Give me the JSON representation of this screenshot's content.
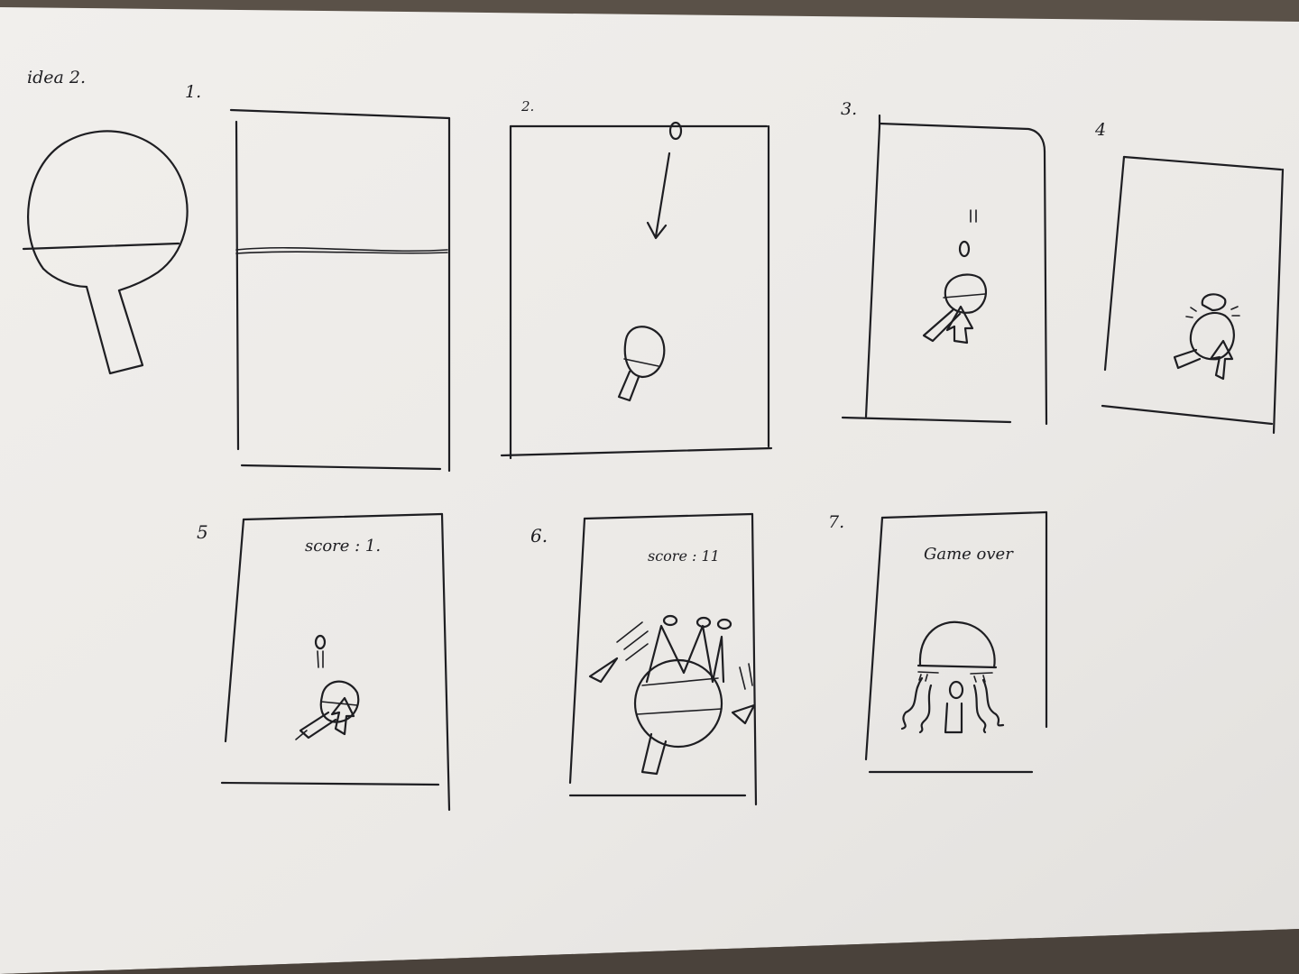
{
  "sheet": {
    "heading": "idea 2.",
    "colors": {
      "paper": "#eeecea",
      "ink": "#1e1e22",
      "background": "#5a5148"
    }
  },
  "panels": [
    {
      "number": "1.",
      "caption": ""
    },
    {
      "number": "2.",
      "caption": ""
    },
    {
      "number": "3.",
      "caption": ""
    },
    {
      "number": "4",
      "caption": ""
    },
    {
      "number": "5",
      "caption": "score : 1."
    },
    {
      "number": "6.",
      "caption": "score : 11"
    },
    {
      "number": "7.",
      "caption": "Game over"
    }
  ],
  "icons": [
    "paddle-icon",
    "ball-icon",
    "arrow-down-icon",
    "cursor-icon",
    "crown-icon",
    "crying-face-icon"
  ]
}
